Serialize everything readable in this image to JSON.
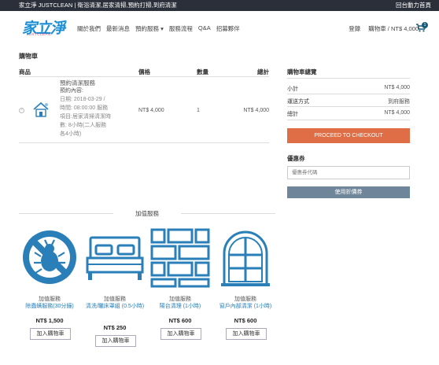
{
  "topbar": {
    "text": "家立淨 JUSTCLEAN | 衛浴清潔,居家清掃,預約打掃,到府清潔",
    "right": "回台動力首頁"
  },
  "logo": {
    "cn": "家立淨",
    "en": "JUSTCLEAN"
  },
  "nav": [
    "關於我們",
    "最新消息",
    "預約服務 ▾",
    "服務流程",
    "Q&A",
    "招募夥伴"
  ],
  "header_right": {
    "login": "登錄",
    "cart": "購物車 / NT$ 4,000",
    "cart_count": "1"
  },
  "page_title": "購物車",
  "table": {
    "headers": {
      "product": "商品",
      "price": "價格",
      "qty": "數量",
      "subtotal": "總計"
    },
    "item": {
      "remove": "×",
      "title": "預約清潔服務",
      "subtitle": "預約內容:",
      "detail": "日期: 2018-03-29 / 時間: 08:00:00 服務項目:居家清掃清潔時數: 8小時(二人服務各4小時)",
      "price": "NT$ 4,000",
      "qty": "1",
      "total": "NT$ 4,000"
    }
  },
  "summary": {
    "title": "購物車總覽",
    "rows": [
      {
        "label": "小計",
        "value": "NT$ 4,000"
      },
      {
        "label": "運送方式",
        "value": "到府服務"
      },
      {
        "label": "總計",
        "value": "NT$ 4,000"
      }
    ],
    "checkout": "PROCEED TO CHECKOUT",
    "coupon_title": "優惠券",
    "coupon_placeholder": "優惠券代碼",
    "coupon_button": "使用折價券"
  },
  "addons": {
    "heading": "加值服務",
    "items": [
      {
        "category": "加值服務",
        "name": "除蟲螨服務(30分鐘)",
        "price": "NT$ 1,500",
        "button": "加入購物車",
        "icon": "no-bug-icon"
      },
      {
        "category": "加值服務",
        "name": "清洗/曬床罩組 (0.5小時)",
        "price": "NT$ 250",
        "button": "加入購物車",
        "icon": "bed-icon"
      },
      {
        "category": "加值服務",
        "name": "陽台清理 (1小時)",
        "price": "NT$ 600",
        "button": "加入購物車",
        "icon": "brick-wall-icon"
      },
      {
        "category": "加值服務",
        "name": "窗戶內部清潔 (1小時)",
        "price": "NT$ 600",
        "button": "加入購物車",
        "icon": "window-icon"
      }
    ]
  },
  "colors": {
    "accent": "#df6d45",
    "brand_blue": "#1a8ed4",
    "icon_blue": "#2a7fb8",
    "coupon_btn": "#6f869a",
    "topbar": "#2b2f3a"
  }
}
